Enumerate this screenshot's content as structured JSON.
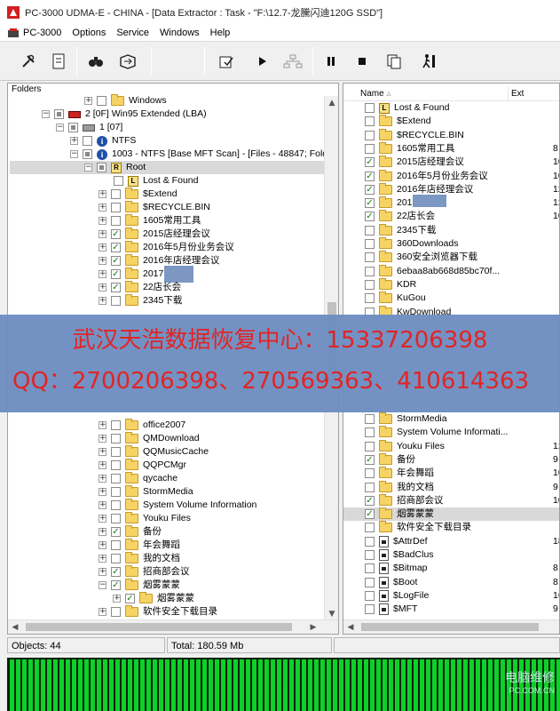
{
  "window": {
    "title": "PC-3000 UDMA-E - CHINA - [Data Extractor : Task - \"F:\\12.7-龙騰闪迪120G SSD\"]"
  },
  "menu": [
    "PC-3000",
    "Options",
    "Service",
    "Windows",
    "Help"
  ],
  "toolbar_icons": [
    "tools-icon",
    "task-info-icon",
    "search-binoculars-icon",
    "export-icon",
    "save-copy-icon",
    "play-icon",
    "network-icon",
    "pause-icon",
    "stop-icon",
    "copy-pages-icon",
    "run-man-icon"
  ],
  "left_panel": {
    "header": "Folders",
    "tree": [
      {
        "label": "Windows"
      },
      {
        "label": "2 [0F] Win95 Extended  (LBA)"
      },
      {
        "label": "1 [07]"
      },
      {
        "label": "NTFS"
      },
      {
        "label": "1003 - NTFS [Base MFT Scan] - [Files - 48847; Folders"
      },
      {
        "label": "Root"
      },
      {
        "label": "Lost & Found"
      },
      {
        "label": "$Extend"
      },
      {
        "label": "$RECYCLE.BIN"
      },
      {
        "label": "1605常用工具"
      },
      {
        "label": "2015店经理会议"
      },
      {
        "label": "2016年5月份业务会议"
      },
      {
        "label": "2016年店经理会议"
      },
      {
        "label": "2017卢"
      },
      {
        "label": "22店长会"
      },
      {
        "label": "2345下载"
      },
      {
        "label": "office2007"
      },
      {
        "label": "QMDownload"
      },
      {
        "label": "QQMusicCache"
      },
      {
        "label": "QQPCMgr"
      },
      {
        "label": "qycache"
      },
      {
        "label": "StormMedia"
      },
      {
        "label": "System Volume Information"
      },
      {
        "label": "Youku Files"
      },
      {
        "label": "备份"
      },
      {
        "label": "年会舞蹈"
      },
      {
        "label": "我的文档"
      },
      {
        "label": "招商部会议"
      },
      {
        "label": "烟雾蒙蒙"
      },
      {
        "label": "烟雾蒙蒙"
      },
      {
        "label": "软件安全下载目录"
      }
    ]
  },
  "right_panel": {
    "columns": [
      "Name",
      "Ext"
    ],
    "rows": [
      {
        "name": "Lost & Found",
        "size": ""
      },
      {
        "name": "$Extend",
        "size": ""
      },
      {
        "name": "$RECYCLE.BIN",
        "size": ""
      },
      {
        "name": "1605常用工具",
        "size": "8"
      },
      {
        "name": "2015店经理会议",
        "size": "10"
      },
      {
        "name": "2016年5月份业务会议",
        "size": "10"
      },
      {
        "name": "2016年店经理会议",
        "size": "12"
      },
      {
        "name": "2017",
        "size": "12"
      },
      {
        "name": "22店长会",
        "size": "10"
      },
      {
        "name": "2345下载",
        "size": ""
      },
      {
        "name": "360Downloads",
        "size": ""
      },
      {
        "name": "360安全浏览器下载",
        "size": ""
      },
      {
        "name": "6ebaa8ab668d85bc70f...",
        "size": ""
      },
      {
        "name": "KDR",
        "size": ""
      },
      {
        "name": "KuGou",
        "size": ""
      },
      {
        "name": "KwDownload",
        "size": ""
      },
      {
        "name": "StormMedia",
        "size": ""
      },
      {
        "name": "System Volume Informati...",
        "size": ""
      },
      {
        "name": "Youku Files",
        "size": "12"
      },
      {
        "name": "备份",
        "size": "9"
      },
      {
        "name": "年会舞蹈",
        "size": "10"
      },
      {
        "name": "我的文档",
        "size": "9"
      },
      {
        "name": "招商部会议",
        "size": "10"
      },
      {
        "name": "烟雾蒙蒙",
        "size": ""
      },
      {
        "name": "软件安全下载目录",
        "size": ""
      },
      {
        "name": "$AttrDef",
        "size": "18"
      },
      {
        "name": "$BadClus",
        "size": ""
      },
      {
        "name": "$Bitmap",
        "size": "8"
      },
      {
        "name": "$Boot",
        "size": "8"
      },
      {
        "name": "$LogFile",
        "size": "16"
      },
      {
        "name": "$MFT",
        "size": "9"
      }
    ]
  },
  "overlay_banner": {
    "line1": "武汉天浩数据恢复中心：15337206398",
    "line2": "QQ：2700206398、270569363、410614363"
  },
  "status": {
    "objects": "Objects: 44",
    "total": "Total: 180.59 Mb"
  },
  "watermark": {
    "line1": "电脑维修",
    "line2": "PC.COM.CN"
  },
  "colors": {
    "banner_bg": "#6f8fc2",
    "banner_text": "#e21d1d",
    "map_block": "#0fcf2a",
    "selection": "#d9d9d9"
  }
}
